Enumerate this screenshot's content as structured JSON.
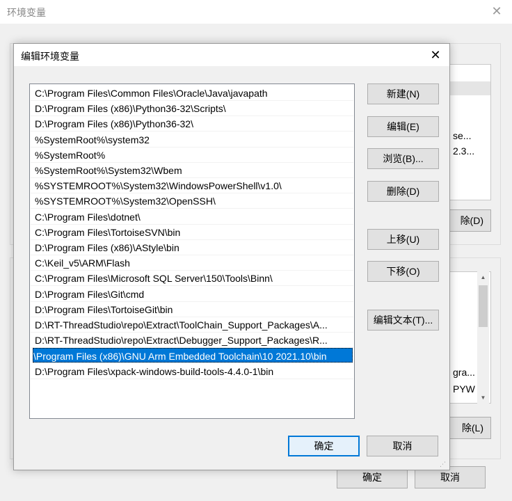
{
  "background_window": {
    "title": "环境变量",
    "close_glyph": "✕",
    "upper_list_fragments": [
      "se...",
      "2.3..."
    ],
    "upper_delete_label": "除(D)",
    "lower_list_fragments": [
      "gra...",
      "PYW"
    ],
    "lower_delete_label": "除(L)",
    "ok_label": "确定",
    "cancel_label": "取消"
  },
  "dialog": {
    "title": "编辑环境变量",
    "close_glyph": "✕",
    "paths": [
      "C:\\Program Files\\Common Files\\Oracle\\Java\\javapath",
      "D:\\Program Files (x86)\\Python36-32\\Scripts\\",
      "D:\\Program Files (x86)\\Python36-32\\",
      "%SystemRoot%\\system32",
      "%SystemRoot%",
      "%SystemRoot%\\System32\\Wbem",
      "%SYSTEMROOT%\\System32\\WindowsPowerShell\\v1.0\\",
      "%SYSTEMROOT%\\System32\\OpenSSH\\",
      "C:\\Program Files\\dotnet\\",
      "C:\\Program Files\\TortoiseSVN\\bin",
      "D:\\Program Files (x86)\\AStyle\\bin",
      "C:\\Keil_v5\\ARM\\Flash",
      "C:\\Program Files\\Microsoft SQL Server\\150\\Tools\\Binn\\",
      "D:\\Program Files\\Git\\cmd",
      "D:\\Program Files\\TortoiseGit\\bin",
      "D:\\RT-ThreadStudio\\repo\\Extract\\ToolChain_Support_Packages\\A...",
      "D:\\RT-ThreadStudio\\repo\\Extract\\Debugger_Support_Packages\\R...",
      "\\Program Files (x86)\\GNU Arm Embedded Toolchain\\10 2021.10\\bin",
      "D:\\Program Files\\xpack-windows-build-tools-4.4.0-1\\bin"
    ],
    "selected_index": 17,
    "buttons": {
      "new": "新建(N)",
      "edit": "编辑(E)",
      "browse": "浏览(B)...",
      "delete": "删除(D)",
      "move_up": "上移(U)",
      "move_down": "下移(O)",
      "edit_text": "编辑文本(T)...",
      "ok": "确定",
      "cancel": "取消"
    }
  },
  "colors": {
    "selection": "#0078d7",
    "default_button_border": "#0078d7"
  }
}
